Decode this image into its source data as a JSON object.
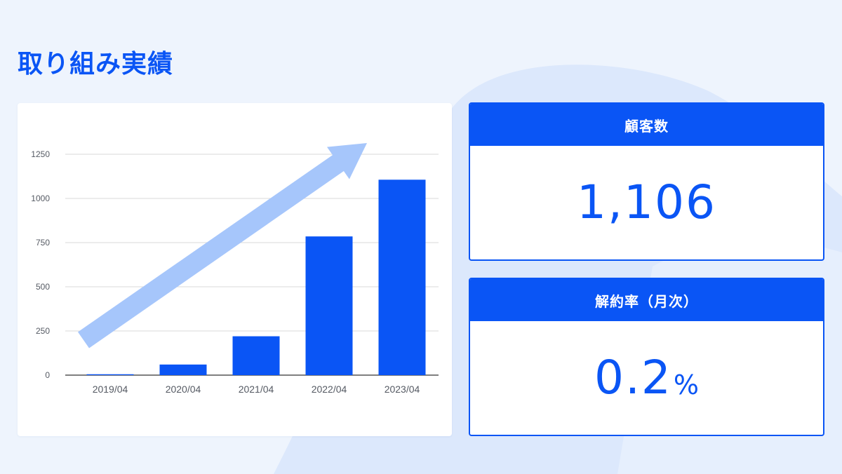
{
  "page": {
    "title": "取り組み実績"
  },
  "colors": {
    "accent": "#0a55f5",
    "arrow": "#a6c6fb",
    "background": "#eef4fd",
    "grid": "#d9d9d9"
  },
  "chart_data": {
    "type": "bar",
    "title": "",
    "xlabel": "",
    "ylabel": "",
    "categories": [
      "2019/04",
      "2020/04",
      "2021/04",
      "2022/04",
      "2023/04"
    ],
    "values": [
      5,
      60,
      220,
      785,
      1106
    ],
    "ylim": [
      0,
      1250
    ],
    "yticks": [
      0,
      250,
      500,
      750,
      1000,
      1250
    ],
    "grid": true,
    "legend": "none",
    "annotations": [
      "upward-trend-arrow"
    ]
  },
  "stats": {
    "customers": {
      "label": "顧客数",
      "value": "1,106"
    },
    "churn": {
      "label": "解約率（月次）",
      "value": "0.2",
      "unit": "%"
    }
  }
}
